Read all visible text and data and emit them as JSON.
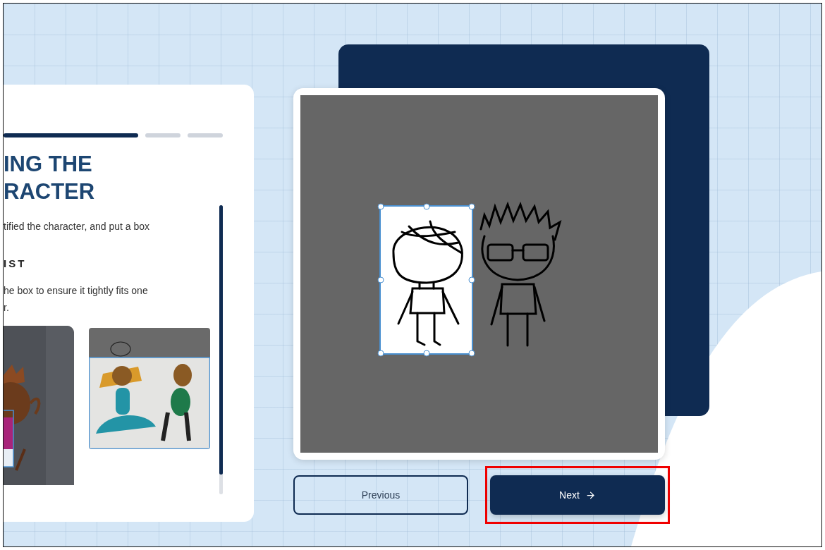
{
  "left_panel": {
    "progress_steps": [
      {
        "selected": true
      },
      {
        "selected": false
      },
      {
        "selected": false
      }
    ],
    "heading_lines": [
      "ING THE",
      "RACTER"
    ],
    "intro": "tified the character, and put a box",
    "checklist_title": "IST",
    "checklist_item": "he box to ensure it tightly fits one\nr.",
    "examples": [
      {
        "kind": "picture"
      },
      {
        "kind": "picture"
      }
    ]
  },
  "canvas": {
    "selection": {
      "selected": true
    }
  },
  "buttons": [
    {
      "label": "Previous",
      "kind": "secondary",
      "highlighted": false
    },
    {
      "label": "Next",
      "kind": "primary",
      "highlighted": true
    }
  ]
}
